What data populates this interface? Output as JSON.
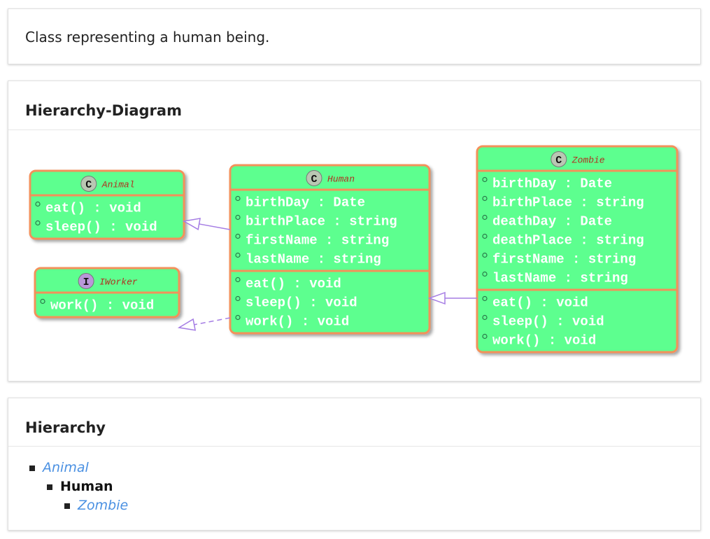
{
  "description": "Class representing a human being.",
  "diagram_section": {
    "title": "Hierarchy-Diagram"
  },
  "hierarchy_section": {
    "title": "Hierarchy"
  },
  "colors": {
    "box_fill": "#5dff8f",
    "box_border": "#f3915a",
    "class_badge": "#b9c7b3",
    "interface_badge": "#b998d9",
    "arrow": "#a57de4",
    "name_text": "#b03020",
    "member_text": "#ffffff",
    "link": "#4a90e2"
  },
  "diagram": {
    "classes": [
      {
        "id": "animal",
        "kind": "class",
        "badge": "C",
        "name": "Animal",
        "fields": [],
        "methods": [
          "eat() : void",
          "sleep() : void"
        ]
      },
      {
        "id": "iworker",
        "kind": "interface",
        "badge": "I",
        "name": "IWorker",
        "fields": [],
        "methods": [
          "work() : void"
        ]
      },
      {
        "id": "human",
        "kind": "class",
        "badge": "C",
        "name": "Human",
        "fields": [
          "birthDay : Date",
          "birthPlace : string",
          "firstName : string",
          "lastName : string"
        ],
        "methods": [
          "eat() : void",
          "sleep() : void",
          "work() : void"
        ]
      },
      {
        "id": "zombie",
        "kind": "class",
        "badge": "C",
        "name": "Zombie",
        "fields": [
          "birthDay : Date",
          "birthPlace : string",
          "deathDay : Date",
          "deathPlace : string",
          "firstName : string",
          "lastName : string"
        ],
        "methods": [
          "eat() : void",
          "sleep() : void",
          "work() : void"
        ]
      }
    ],
    "relations": [
      {
        "from": "human",
        "to": "animal",
        "type": "extends"
      },
      {
        "from": "human",
        "to": "iworker",
        "type": "implements"
      },
      {
        "from": "zombie",
        "to": "human",
        "type": "extends"
      }
    ]
  },
  "hierarchy": [
    {
      "name": "Animal",
      "current": false
    },
    {
      "name": "Human",
      "current": true
    },
    {
      "name": "Zombie",
      "current": false
    }
  ]
}
